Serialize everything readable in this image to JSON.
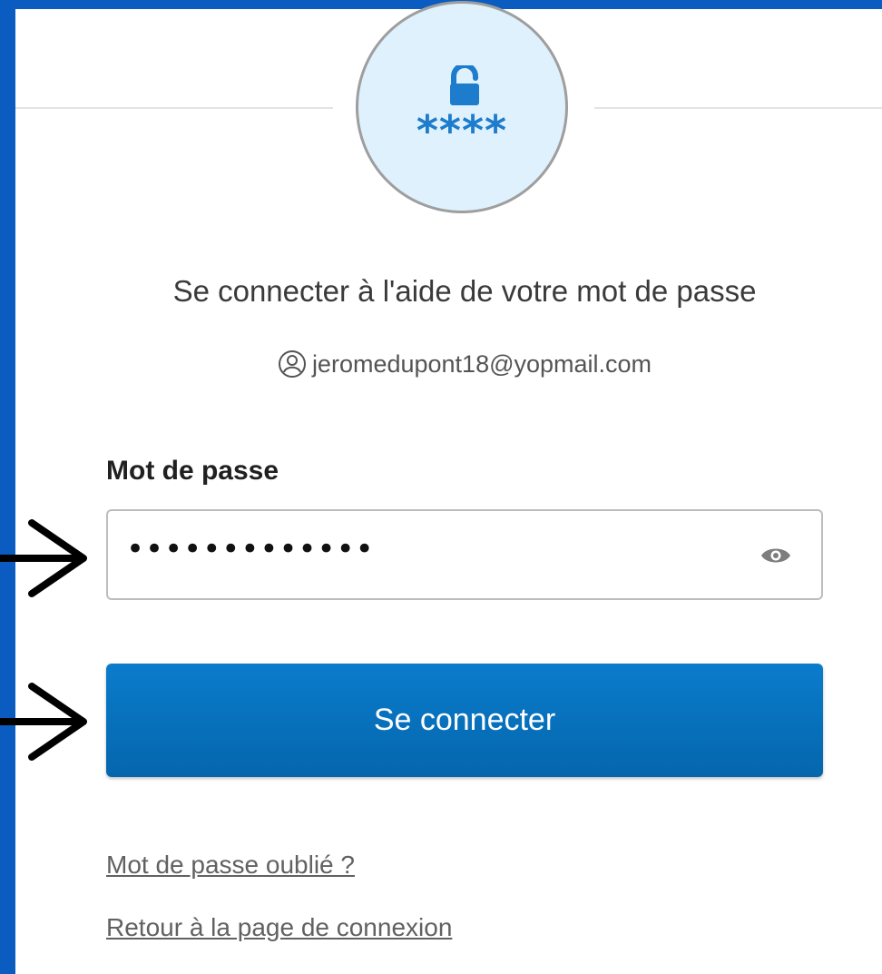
{
  "colors": {
    "frame_border": "#0a5cc0",
    "accent": "#0a6fbf",
    "badge_bg": "#dff1fc",
    "stars": "#1d7ccc"
  },
  "badge": {
    "icon": "unlock-icon",
    "stars": "****"
  },
  "heading": "Se connecter à l'aide de votre mot de passe",
  "user": {
    "icon": "user-circle-icon",
    "email": "jeromedupont18@yopmail.com"
  },
  "password": {
    "label": "Mot de passe",
    "masked_value": "•••••••••••••",
    "toggle_icon": "eye-icon"
  },
  "submit_label": "Se connecter",
  "links": {
    "forgot": "Mot de passe oublié ?",
    "back": "Retour à la page de connexion"
  },
  "annotations": {
    "arrow_icon": "right-arrow-icon"
  }
}
